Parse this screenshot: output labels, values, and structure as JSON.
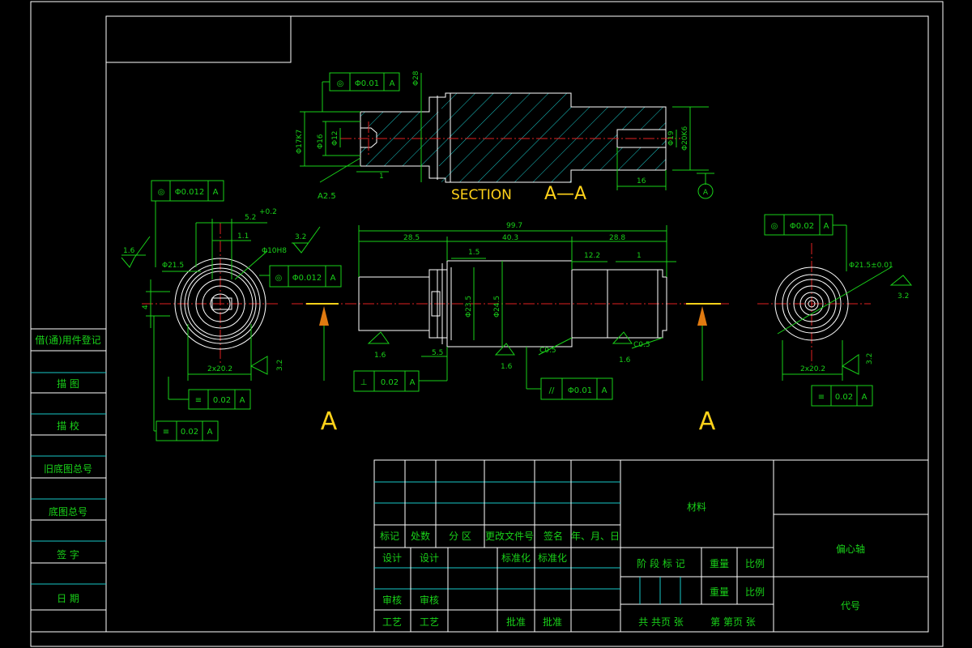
{
  "section": {
    "title": "SECTION",
    "mark": "A—A",
    "datum": "A",
    "angle": "A2.5"
  },
  "view_labels": {
    "left_arrow": "A",
    "right_arrow": "A"
  },
  "dims": {
    "d28": "Φ28",
    "d17k7": "Φ17K7",
    "d16": "Φ16",
    "d12": "Φ12",
    "d19": "Φ19",
    "d20k6": "Φ20K6",
    "len16": "16",
    "len1a": "1",
    "total": "99.7",
    "l285": "28.5",
    "l403": "40.3",
    "l288": "28.8",
    "l15": "1.5",
    "l122": "12.2",
    "l1b": "1",
    "l55": "5.5",
    "d235": "Φ23.5",
    "d245": "Φ24.5",
    "c05a": "C0.5",
    "c05b": "C0.5",
    "r16a": "1.6",
    "r16b": "1.6",
    "r16c": "1.6",
    "left_d215": "Φ21.5",
    "left_key": "5.2",
    "left_key_tol": "+0.2",
    "left_11": "1.1",
    "left_10h8": "Φ10H8",
    "left_4": "4",
    "left_2x202": "2x20.2",
    "left_r16": "1.6",
    "left_r32a": "3.2",
    "left_r32b": "3.2",
    "right_d215": "Φ21.5±0.01",
    "right_2x202": "2x20.2",
    "right_r32a": "3.2",
    "right_r32b": "3.2"
  },
  "tolerances": {
    "t1": {
      "symbol": "◎",
      "value": "Φ0.01",
      "datum": "A"
    },
    "t2": {
      "symbol": "◎",
      "value": "Φ0.012",
      "datum": "A"
    },
    "t3": {
      "symbol": "◎",
      "value": "Φ0.012",
      "datum": "A"
    },
    "t4": {
      "symbol": "◎",
      "value": "Φ0.02",
      "datum": "A"
    },
    "t5": {
      "symbol": "⊥",
      "value": "0.02",
      "datum": "A"
    },
    "t6": {
      "symbol": "//",
      "value": "Φ0.01",
      "datum": "A"
    },
    "t7": {
      "symbol": "≡",
      "value": "0.02",
      "datum": "A"
    },
    "t8": {
      "symbol": "≡",
      "value": "0.02",
      "datum": "A"
    },
    "t9": {
      "symbol": "≡",
      "value": "0.02",
      "datum": "A"
    }
  },
  "side_panel": [
    "借(通)用件登记",
    "描 图",
    "描 校",
    "旧底图总号",
    "底图总号",
    "签 字",
    "日 期"
  ],
  "title_block": {
    "header": [
      "标记",
      "处数",
      "分 区",
      "更改文件号",
      "签名",
      "年、月、日"
    ],
    "r1": [
      "设计",
      "设计",
      "标准化",
      "标准化"
    ],
    "r3": [
      "审核",
      "审核"
    ],
    "r4": [
      "工艺",
      "工艺",
      "批准",
      "批准"
    ],
    "material": "材料",
    "part_name": "偏心轴",
    "code": "代号",
    "stage": "阶 段 标 记",
    "weight1": "重量",
    "scale1": "比例",
    "weight2": "重量",
    "scale2": "比例",
    "sheets": "共 共页 张",
    "sheet_no": "第 第页 张"
  }
}
